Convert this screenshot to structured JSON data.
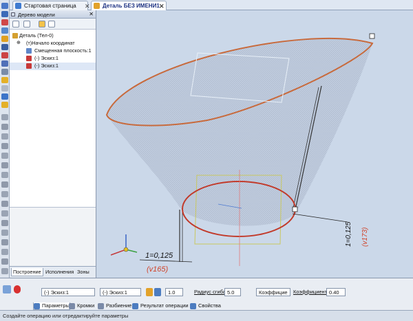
{
  "tabs": [
    {
      "label": "Стартовая страница"
    },
    {
      "label": "Деталь БЕЗ ИМЕНИ1"
    }
  ],
  "tree": {
    "title": "Дерево модели",
    "items": [
      {
        "label": "Деталь (Тел-0)"
      },
      {
        "label": "(т)Начало координат"
      },
      {
        "label": "Смещенная плоскость:1"
      },
      {
        "label": "(-) Эскиз:1"
      },
      {
        "label": "(-) Эскиз:1"
      }
    ],
    "bottom_tabs": [
      "Построение",
      "Исполнения",
      "Зоны"
    ]
  },
  "viewport": {
    "dim1_text": "1=0,125",
    "dim1_sub": "(v165)",
    "dim2_text": "1=0,125",
    "dim2_sub": "(v173)",
    "corner_marker": "1"
  },
  "props": {
    "sketch1": "(-) Эскиз:1",
    "sketch2": "(-) Эскиз:1",
    "thickness": "1.0",
    "radius_label": "Радиус сгиба",
    "radius_value": "5.0",
    "coef_type": "Коэффицие",
    "coef_label": "Коэффициент",
    "coef_value": "0.40",
    "tabs": [
      "Параметры",
      "Кромки",
      "Разбиение",
      "Результат операции",
      "Свойства"
    ]
  },
  "status": {
    "text": "Создайте операцию или отредактируйте параметры"
  },
  "colors": {
    "accent": "#1a2f80",
    "edge": "#c86a3c",
    "dim_red": "#d0442a"
  }
}
